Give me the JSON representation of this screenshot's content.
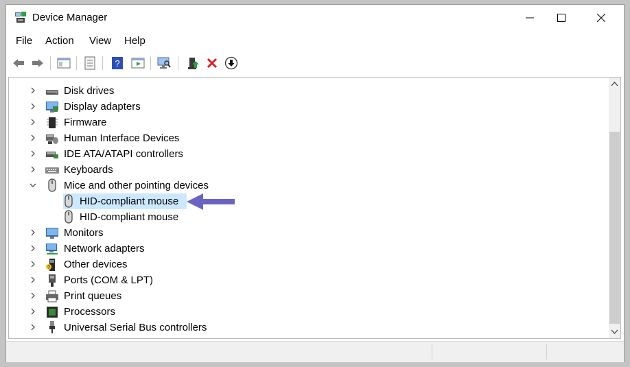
{
  "window": {
    "title": "Device Manager"
  },
  "menu": [
    "File",
    "Action",
    "View",
    "Help"
  ],
  "toolbar": [
    "back-icon",
    "forward-icon",
    "properties-view-icon",
    "details-icon",
    "help-icon",
    "run-icon",
    "scan-hardware-icon",
    "update-driver-icon",
    "uninstall-icon",
    "disable-icon"
  ],
  "tree": [
    {
      "label": "Disk drives",
      "state": "collapsed",
      "icon": "disk-drive-icon"
    },
    {
      "label": "Display adapters",
      "state": "collapsed",
      "icon": "display-adapter-icon"
    },
    {
      "label": "Firmware",
      "state": "collapsed",
      "icon": "firmware-icon"
    },
    {
      "label": "Human Interface Devices",
      "state": "collapsed",
      "icon": "hid-icon"
    },
    {
      "label": "IDE ATA/ATAPI controllers",
      "state": "collapsed",
      "icon": "ide-controller-icon"
    },
    {
      "label": "Keyboards",
      "state": "collapsed",
      "icon": "keyboard-icon"
    },
    {
      "label": "Mice and other pointing devices",
      "state": "expanded",
      "icon": "mouse-icon"
    },
    {
      "label": "HID-compliant mouse",
      "child": true,
      "selected": true,
      "icon": "mouse-icon"
    },
    {
      "label": "HID-compliant mouse",
      "child": true,
      "icon": "mouse-icon"
    },
    {
      "label": "Monitors",
      "state": "collapsed",
      "icon": "monitor-icon"
    },
    {
      "label": "Network adapters",
      "state": "collapsed",
      "icon": "network-adapter-icon"
    },
    {
      "label": "Other devices",
      "state": "collapsed",
      "icon": "other-devices-icon"
    },
    {
      "label": "Ports (COM & LPT)",
      "state": "collapsed",
      "icon": "port-icon"
    },
    {
      "label": "Print queues",
      "state": "collapsed",
      "icon": "printer-icon"
    },
    {
      "label": "Processors",
      "state": "collapsed",
      "icon": "processor-icon"
    },
    {
      "label": "Universal Serial Bus controllers",
      "state": "collapsed",
      "icon": "usb-icon"
    }
  ],
  "colors": {
    "selection": "#cce8ff",
    "annotation_arrow": "#6b63c4"
  }
}
